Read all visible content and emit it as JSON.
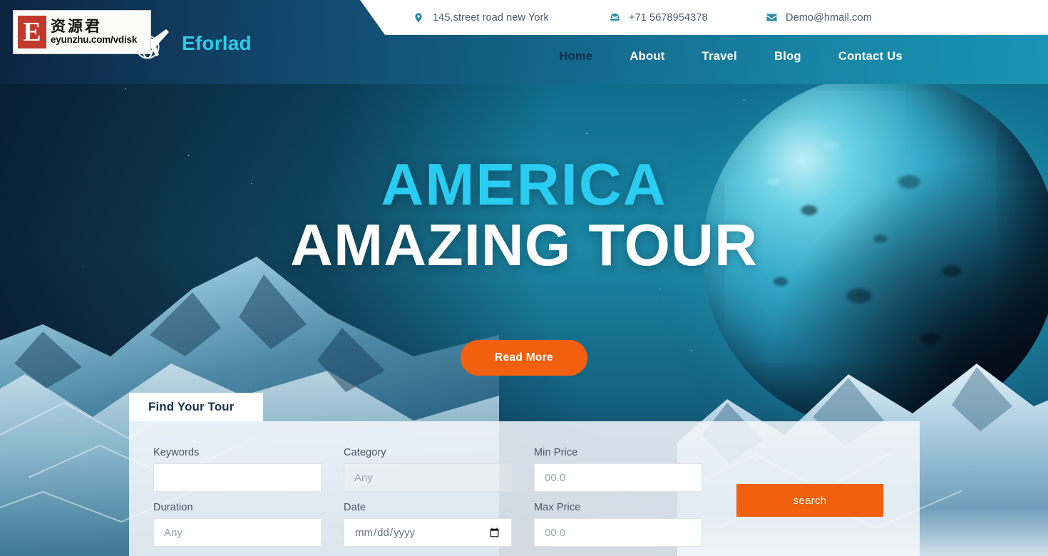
{
  "topbar": {
    "contacts": [
      {
        "icon": "map-pin-icon",
        "text": "145.street road new York"
      },
      {
        "icon": "telephone-icon",
        "text": "+71 5678954378"
      },
      {
        "icon": "envelope-icon",
        "text": "Demo@hmail.com"
      }
    ]
  },
  "brand": {
    "name": "Eforlad",
    "logo_icon": "globe-airplane-logo",
    "accent_color": "#2ecdea"
  },
  "nav": {
    "items": [
      {
        "label": "Home",
        "active": true
      },
      {
        "label": "About",
        "active": false
      },
      {
        "label": "Travel",
        "active": false
      },
      {
        "label": "Blog",
        "active": false
      },
      {
        "label": "Contact Us",
        "active": false
      }
    ]
  },
  "hero": {
    "title_line1": "AMERICA",
    "title_line2": "AMAZING TOUR",
    "title_line1_color": "#29cdf2",
    "title_line2_color": "#ffffff",
    "cta_label": "Read More",
    "cta_color": "#f2600f"
  },
  "search_form": {
    "tab_label": "Find Your Tour",
    "fields": [
      {
        "label": "Keywords",
        "type": "text",
        "value": "",
        "placeholder": ""
      },
      {
        "label": "Category",
        "type": "select",
        "value": "Any",
        "options": [
          "Any"
        ]
      },
      {
        "label": "Min Price",
        "type": "text",
        "value": "",
        "placeholder": "00.0"
      },
      {
        "label": "Duration",
        "type": "text",
        "value": "",
        "placeholder": "Any"
      },
      {
        "label": "Date",
        "type": "date",
        "value": "",
        "placeholder": "mm/dd/yyyy"
      },
      {
        "label": "Max Price",
        "type": "text",
        "value": "",
        "placeholder": "00.0"
      }
    ],
    "submit_label": "search",
    "submit_color": "#f2600f"
  },
  "watermark": {
    "badge": "E",
    "chinese": "资源君",
    "url": "eyunzhu.com/vdisk"
  }
}
